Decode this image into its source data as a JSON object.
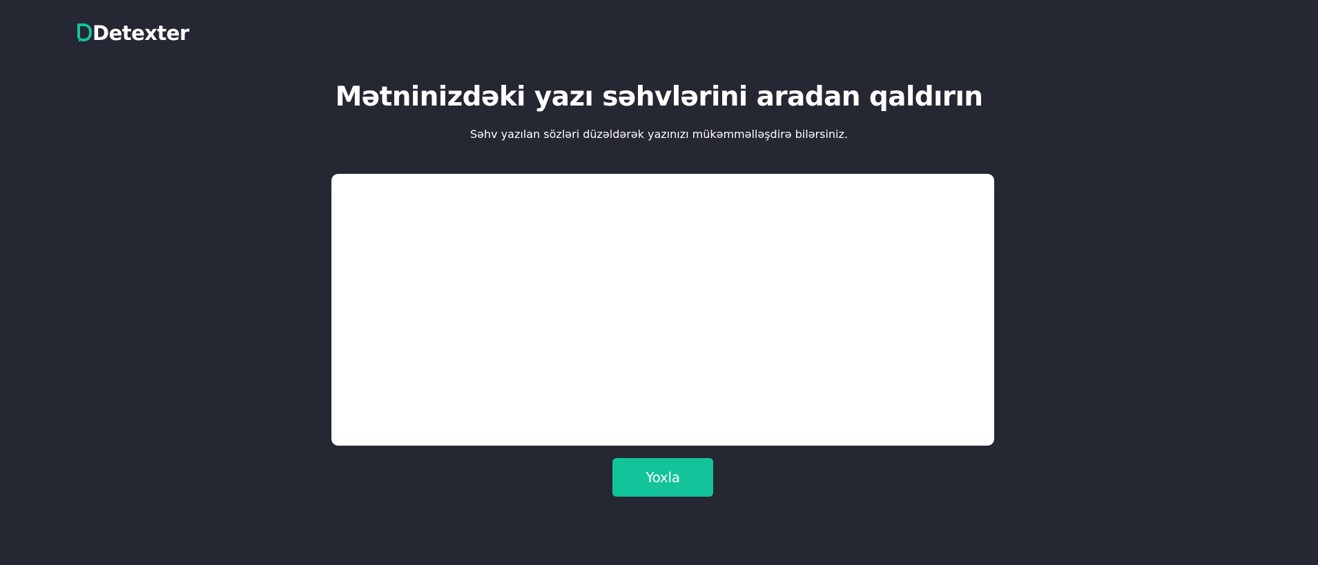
{
  "header": {
    "logo_text": "Detexter",
    "logo_icon": "d-speech-bubble-logo-icon"
  },
  "hero": {
    "title": "Mətninizdəki yazı səhvlərini aradan qaldırın",
    "subtitle": "Səhv yazılan sözləri düzəldərək yazınızı mükəmməlləşdirə bilərsiniz."
  },
  "editor": {
    "value": "",
    "placeholder": ""
  },
  "actions": {
    "check_label": "Yoxla"
  },
  "colors": {
    "background": "#252733",
    "accent": "#13C39A",
    "text": "#FFFFFF",
    "input_background": "#FFFFFF"
  }
}
